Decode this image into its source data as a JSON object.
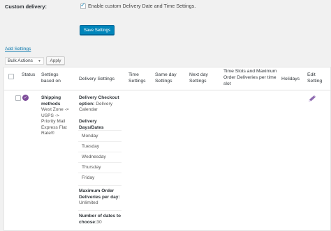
{
  "settings": {
    "custom_delivery_label": "Custom delivery:",
    "enable_label": "Enable custom Delivery Date and Time Settings.",
    "enable_checked": true,
    "save_button": "Save Settings",
    "add_settings_link": "Add Settings"
  },
  "bulk": {
    "selected": "Bulk Actions",
    "apply_button": "Apply"
  },
  "table": {
    "headers": {
      "status": "Status",
      "settings_based_on": "Settings based on",
      "delivery_settings": "Delivery Settings",
      "time_settings": "Time Settings",
      "same_day_settings": "Same day Settings",
      "next_day_settings": "Next day Settings",
      "time_slots": "Time Slots and Maximum Order Deliveries per time slot",
      "holidays": "Holidays",
      "edit_setting": "Edit Setting"
    },
    "row": {
      "status_color": "#7d4c9a",
      "based_on_title": "Shipping methods",
      "based_on_value": "West Zone -> USPS -> Priority Mail Express Flat Rate®",
      "checkout_option_label": "Delivery Checkout option:",
      "checkout_option_value": "Delivery Calendar",
      "delivery_days_label": "Delivery Days/Dates",
      "days": [
        "Monday",
        "Tuesday",
        "Wednesday",
        "Thursday",
        "Friday"
      ],
      "max_order_label": "Maximum Order Deliveries per day:",
      "max_order_value": "Unlimited",
      "num_dates_label": "Number of dates to choose:",
      "num_dates_value": "30",
      "edit_icon": "pencil-icon"
    }
  },
  "colors": {
    "primary_button": "#0085ba",
    "link": "#0073aa",
    "status": "#7d4c9a",
    "edit_icon": "#8e6bb0"
  }
}
